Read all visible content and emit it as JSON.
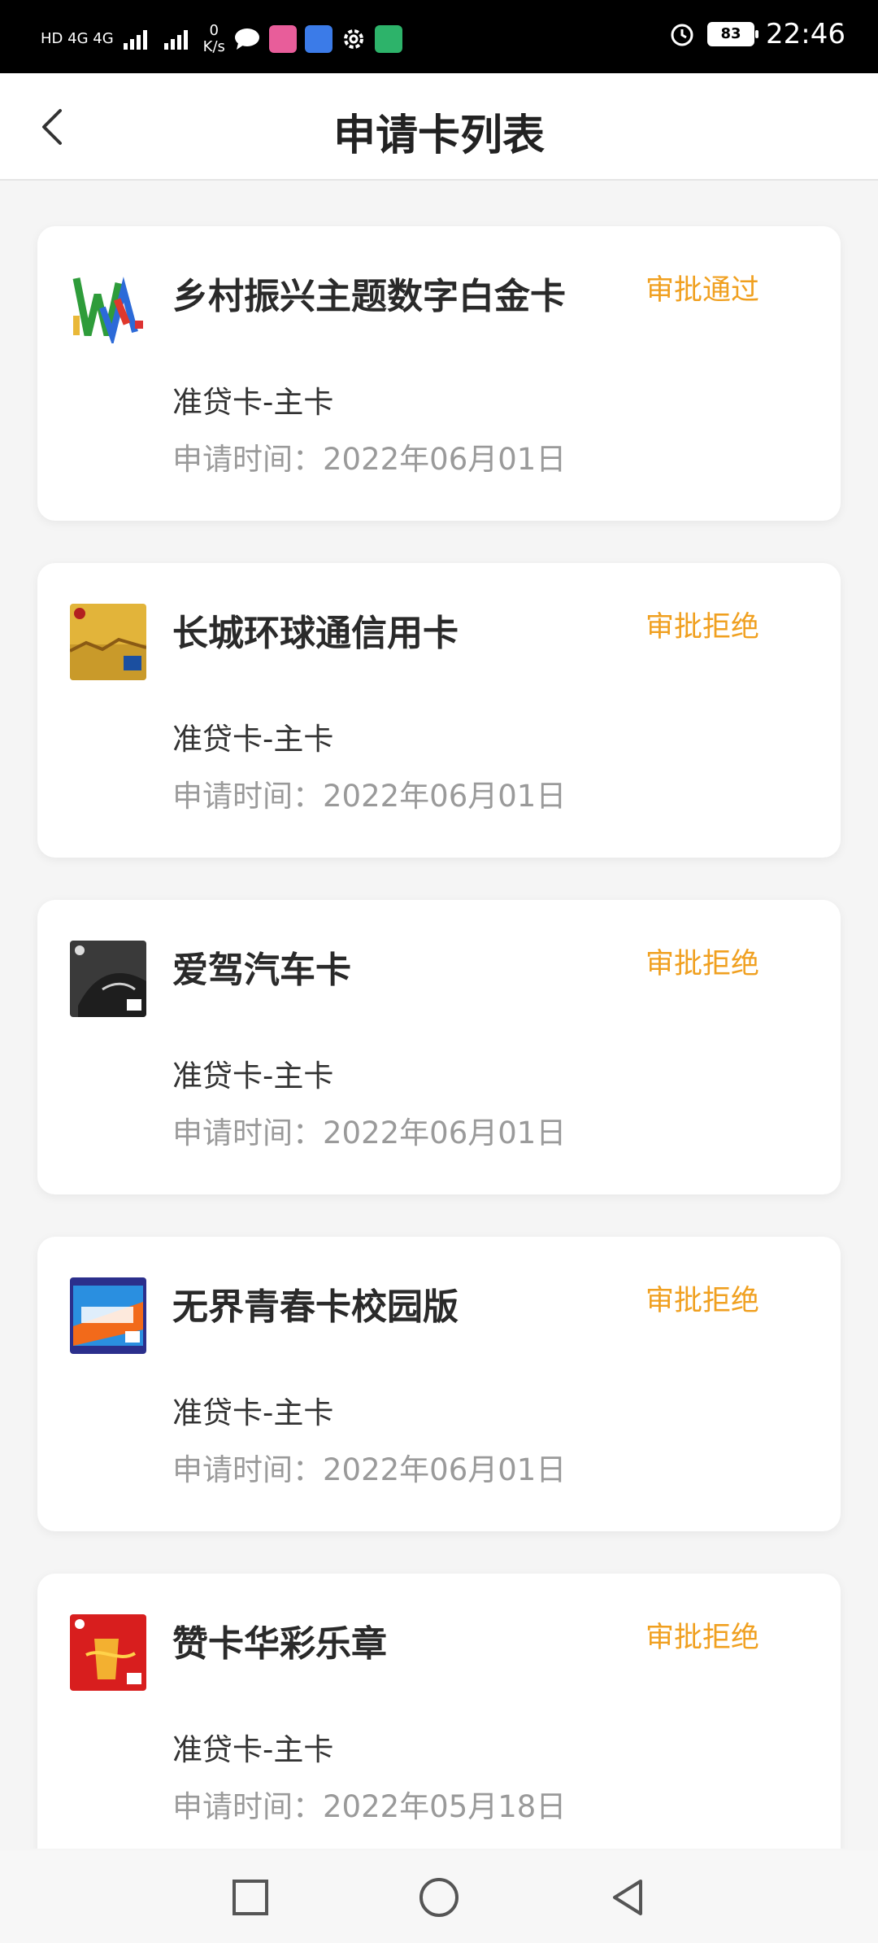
{
  "status_bar": {
    "network": "HD 4G 4G",
    "speed_value": "0",
    "speed_unit": "K/s",
    "battery": "83",
    "time": "22:46"
  },
  "header": {
    "title": "申请卡列表"
  },
  "cards": [
    {
      "name": "乡村振兴主题数字白金卡",
      "status": "审批通过",
      "type": "准贷卡-主卡",
      "date": "申请时间：2022年06月01日"
    },
    {
      "name": "长城环球通信用卡",
      "status": "审批拒绝",
      "type": "准贷卡-主卡",
      "date": "申请时间：2022年06月01日"
    },
    {
      "name": "爱驾汽车卡",
      "status": "审批拒绝",
      "type": "准贷卡-主卡",
      "date": "申请时间：2022年06月01日"
    },
    {
      "name": "无界青春卡校园版",
      "status": "审批拒绝",
      "type": "准贷卡-主卡",
      "date": "申请时间：2022年06月01日"
    },
    {
      "name": "赞卡华彩乐章",
      "status": "审批拒绝",
      "type": "准贷卡-主卡",
      "date": "申请时间：2022年05月18日"
    }
  ],
  "colors": {
    "status": "#f0a020",
    "background": "#f5f5f5"
  }
}
